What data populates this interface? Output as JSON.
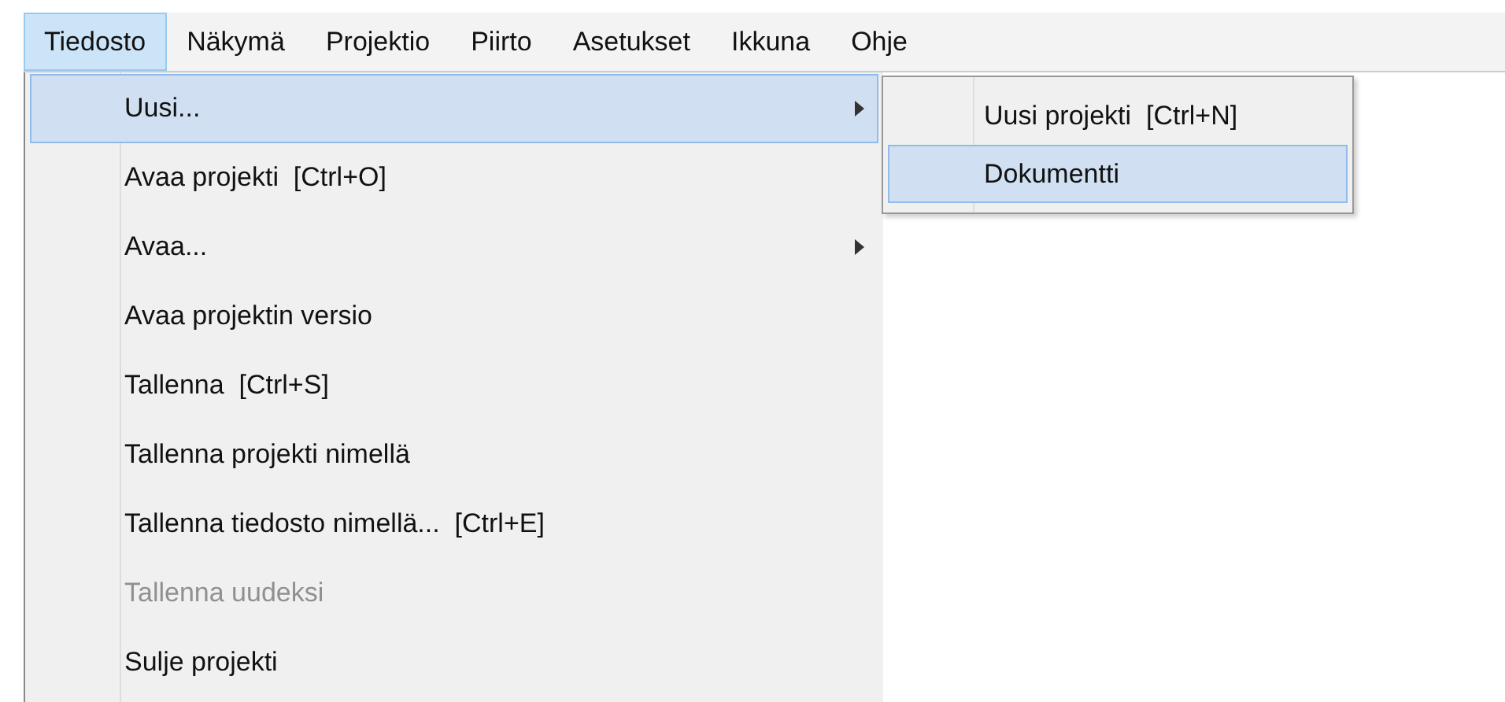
{
  "menubar": [
    {
      "label": "Tiedosto",
      "selected": true
    },
    {
      "label": "Näkymä",
      "selected": false
    },
    {
      "label": "Projektio",
      "selected": false
    },
    {
      "label": "Piirto",
      "selected": false
    },
    {
      "label": "Asetukset",
      "selected": false
    },
    {
      "label": "Ikkuna",
      "selected": false
    },
    {
      "label": "Ohje",
      "selected": false
    }
  ],
  "menu": [
    {
      "label": "Uusi...",
      "selected": true,
      "disabled": false,
      "submenu": true
    },
    {
      "label": "Avaa projekti  [Ctrl+O]",
      "selected": false,
      "disabled": false,
      "submenu": false
    },
    {
      "label": "Avaa...",
      "selected": false,
      "disabled": false,
      "submenu": true
    },
    {
      "label": "Avaa projektin versio",
      "selected": false,
      "disabled": false,
      "submenu": false
    },
    {
      "label": "Tallenna  [Ctrl+S]",
      "selected": false,
      "disabled": false,
      "submenu": false
    },
    {
      "label": "Tallenna projekti nimellä",
      "selected": false,
      "disabled": false,
      "submenu": false
    },
    {
      "label": "Tallenna tiedosto nimellä...  [Ctrl+E]",
      "selected": false,
      "disabled": false,
      "submenu": false
    },
    {
      "label": "Tallenna uudeksi",
      "selected": false,
      "disabled": true,
      "submenu": false
    },
    {
      "label": "Sulje projekti",
      "selected": false,
      "disabled": false,
      "submenu": false
    }
  ],
  "submenu": [
    {
      "label": "Uusi projekti  [Ctrl+N]",
      "selected": false
    },
    {
      "label": "Dokumentti",
      "selected": true
    }
  ]
}
